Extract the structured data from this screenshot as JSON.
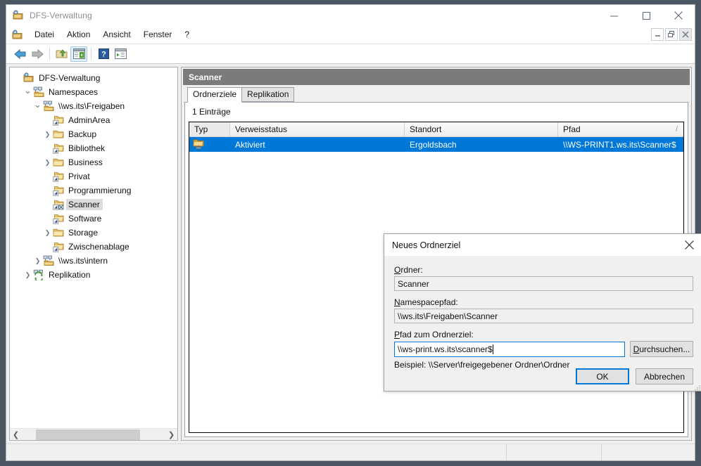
{
  "window": {
    "title": "DFS-Verwaltung",
    "icon": "dfs-app-icon",
    "controls": {
      "minimize": "minimize-icon",
      "maximize": "maximize-icon",
      "close": "close-icon"
    }
  },
  "menubar": {
    "icon": "dfs-app-icon",
    "items": [
      {
        "label": "Datei"
      },
      {
        "label": "Aktion"
      },
      {
        "label": "Ansicht"
      },
      {
        "label": "Fenster"
      },
      {
        "label": "?"
      }
    ],
    "mdi_controls": {
      "minimize": "mdi-minimize-icon",
      "restore": "mdi-restore-icon",
      "close": "mdi-close-icon"
    }
  },
  "toolbar": {
    "buttons": [
      {
        "name": "back-button",
        "icon": "back-arrow-icon"
      },
      {
        "name": "forward-button",
        "icon": "forward-arrow-icon"
      },
      {
        "name": "up-folder-button",
        "icon": "up-folder-icon"
      },
      {
        "name": "show-hide-console-tree-button",
        "icon": "console-tree-icon",
        "active": true
      },
      {
        "name": "help-button",
        "icon": "help-question-icon"
      },
      {
        "name": "export-list-button",
        "icon": "export-list-icon"
      }
    ]
  },
  "tree": {
    "items": [
      {
        "label": "DFS-Verwaltung",
        "depth": 0,
        "chevron": "none",
        "icon": "dfs-root-icon",
        "selected": false
      },
      {
        "label": "Namespaces",
        "depth": 1,
        "chevron": "down",
        "icon": "namespaces-icon",
        "selected": false
      },
      {
        "label": "\\\\ws.its\\Freigaben",
        "depth": 2,
        "chevron": "down",
        "icon": "namespace-icon",
        "selected": false
      },
      {
        "label": "AdminArea",
        "depth": 3,
        "chevron": "none",
        "icon": "dfs-link-folder-icon",
        "selected": false
      },
      {
        "label": "Backup",
        "depth": 3,
        "chevron": "right",
        "icon": "folder-icon",
        "selected": false
      },
      {
        "label": "Bibliothek",
        "depth": 3,
        "chevron": "none",
        "icon": "dfs-link-folder-icon",
        "selected": false
      },
      {
        "label": "Business",
        "depth": 3,
        "chevron": "right",
        "icon": "folder-icon",
        "selected": false
      },
      {
        "label": "Privat",
        "depth": 3,
        "chevron": "none",
        "icon": "dfs-link-folder-icon",
        "selected": false
      },
      {
        "label": "Programmierung",
        "depth": 3,
        "chevron": "none",
        "icon": "dfs-link-folder-icon",
        "selected": false
      },
      {
        "label": "Scanner",
        "depth": 3,
        "chevron": "none",
        "icon": "dfs-link-folder-open-icon",
        "selected": true
      },
      {
        "label": "Software",
        "depth": 3,
        "chevron": "none",
        "icon": "dfs-link-folder-icon",
        "selected": false
      },
      {
        "label": "Storage",
        "depth": 3,
        "chevron": "right",
        "icon": "folder-icon",
        "selected": false
      },
      {
        "label": "Zwischenablage",
        "depth": 3,
        "chevron": "none",
        "icon": "dfs-link-folder-icon",
        "selected": false
      },
      {
        "label": "\\\\ws.its\\intern",
        "depth": 2,
        "chevron": "right",
        "icon": "namespace-icon",
        "selected": false
      },
      {
        "label": "Replikation",
        "depth": 1,
        "chevron": "right",
        "icon": "replication-icon",
        "selected": false
      }
    ],
    "hscroll": {
      "left_arrow": "scroll-left-icon",
      "right_arrow": "scroll-right-icon"
    }
  },
  "content": {
    "header": "Scanner",
    "tabs": [
      {
        "label": "Ordnerziele",
        "active": true
      },
      {
        "label": "Replikation",
        "active": false
      }
    ],
    "entry_count": "1 Einträge",
    "table": {
      "columns": [
        "Typ",
        "Verweisstatus",
        "Standort",
        "Pfad"
      ],
      "sort_mark": "/",
      "rows": [
        {
          "icon": "folder-target-icon",
          "typ": "",
          "verweisstatus": "Aktiviert",
          "standort": "Ergoldsbach",
          "pfad": "\\\\WS-PRINT1.ws.its\\Scanner$",
          "selected": true
        }
      ]
    }
  },
  "dialog": {
    "title": "Neues Ordnerziel",
    "close_icon": "close-icon",
    "fields": [
      {
        "label": "Ordner:",
        "accel": "O",
        "value": "Scanner",
        "readonly": true
      },
      {
        "label": "Namespacepfad:",
        "accel": "N",
        "value": "\\\\ws.its\\Freigaben\\Scanner",
        "readonly": true
      }
    ],
    "target": {
      "label": "Pfad zum Ordnerziel:",
      "accel": "P",
      "value": "\\\\ws-print.ws.its\\scanner$",
      "browse_label": "Durchsuchen...",
      "browse_accel": "D"
    },
    "hint": "Beispiel: \\\\Server\\freigegebener Ordner\\Ordner",
    "ok_label": "OK",
    "cancel_label": "Abbrechen",
    "resize_grip": "resize-grip-icon"
  },
  "statusbar": {
    "segments": [
      "",
      "",
      ""
    ]
  },
  "colors": {
    "desktop": "#4c5764",
    "accent_selection": "#0078d7",
    "content_header": "#7b7b7b",
    "window_bg": "#f0f0f0"
  }
}
